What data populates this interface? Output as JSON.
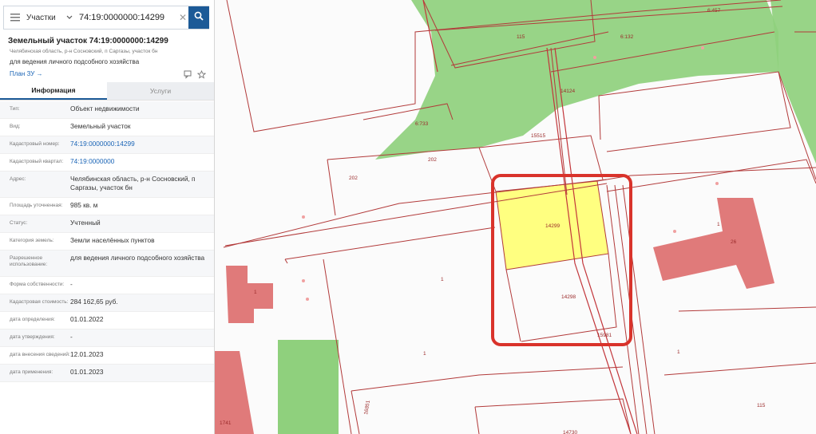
{
  "search": {
    "layer": "Участки",
    "query": "74:19:0000000:14299"
  },
  "card": {
    "title": "Земельный участок 74:19:0000000:14299",
    "address_small": "Челябинская область, р-н Сосновский, п Саргазы, участок бн",
    "purpose": "для ведения личного подсобного хозяйства",
    "plan_link": "План ЗУ →"
  },
  "tabs": [
    {
      "label": "Информация",
      "active": true
    },
    {
      "label": "Услуги",
      "active": false
    }
  ],
  "info": [
    {
      "key": "Тип:",
      "value": "Объект недвижимости"
    },
    {
      "key": "Вид:",
      "value": "Земельный участок"
    },
    {
      "key": "Кадастровый номер:",
      "value": "74:19:0000000:14299",
      "link": true
    },
    {
      "key": "Кадастровый квартал:",
      "value": "74:19:0000000",
      "link": true
    },
    {
      "key": "Адрес:",
      "value": "Челябинская область, р-н Сосновский, п Саргазы, участок бн"
    },
    {
      "key": "Площадь уточненная:",
      "value": "985 кв. м"
    },
    {
      "key": "Статус:",
      "value": "Учтенный"
    },
    {
      "key": "Категория земель:",
      "value": "Земли населённых пунктов"
    },
    {
      "key": "Разрешенное использование:",
      "value": "для ведения личного подсобного хозяйства"
    },
    {
      "key": "Форма собственности:",
      "value": "-"
    },
    {
      "key": "Кадастровая стоимость:",
      "value": "284 162,65 руб."
    },
    {
      "key": "дата определения:",
      "value": "01.01.2022"
    },
    {
      "key": "дата утверждения:",
      "value": "-"
    },
    {
      "key": "дата внесения сведений:",
      "value": "12.01.2023"
    },
    {
      "key": "дата применения:",
      "value": "01.01.2023"
    }
  ],
  "map_labels": {
    "l115a": "115",
    "l132": "6:132",
    "l457": "6:457",
    "l14124": "14124",
    "l733": "6:733",
    "l15515": "15515",
    "l202a": "202",
    "l202b": "202",
    "l14299": "14299",
    "l14298": "14298",
    "l15981": "15981",
    "l1a": "1",
    "l1b": "1",
    "l1c": "1",
    "l1d": "1",
    "l1e": "1",
    "l26": "26",
    "l115b": "115",
    "l16851": "16851",
    "l14730": "14730",
    "l1741": "1741"
  },
  "colors": {
    "accent": "#1c5a97",
    "green_zone": "#8fd07d",
    "building": "#e07a7a",
    "selected_parcel": "#ffff80",
    "highlight_frame": "#d9332b",
    "boundary": "#b23a3a"
  }
}
